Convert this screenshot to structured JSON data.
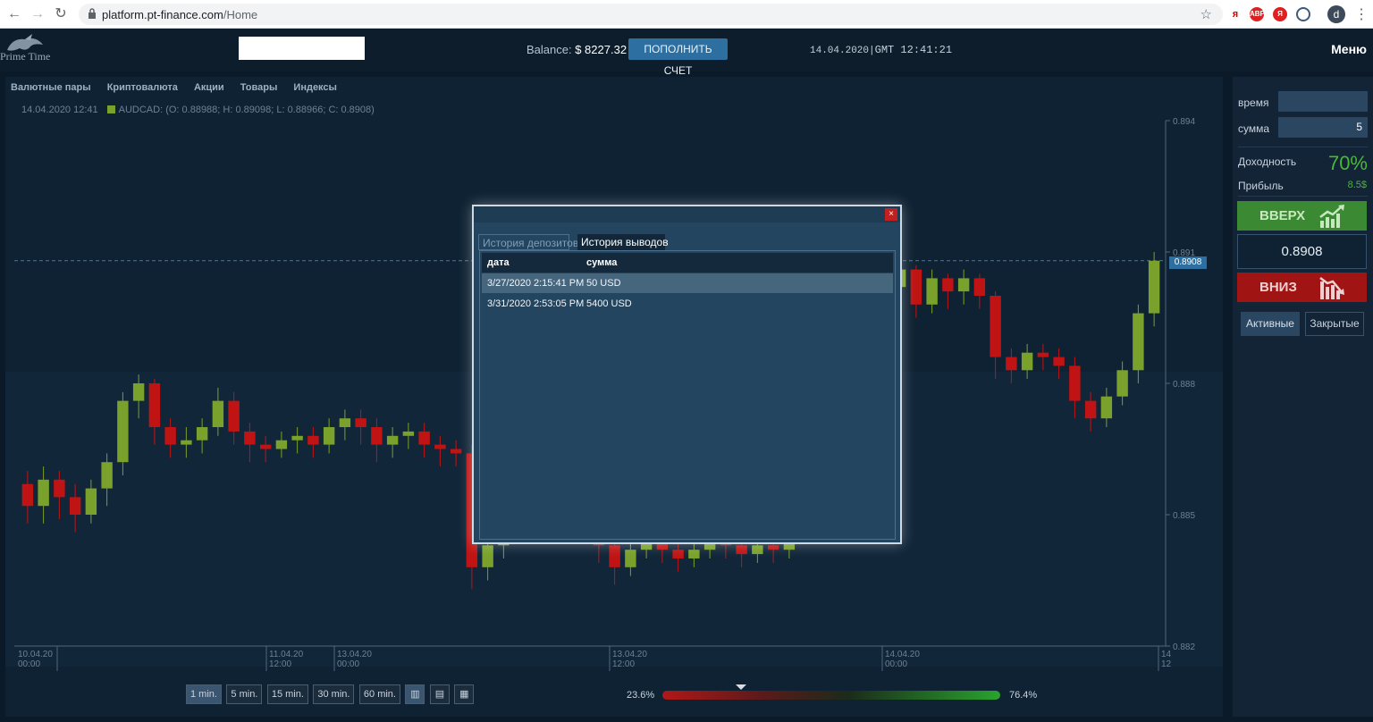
{
  "browser": {
    "url_host": "platform.pt-finance.com",
    "url_path": "/Home",
    "profile_initial": "d"
  },
  "header": {
    "logo_text": "Prime Time",
    "balance_label": "Balance:",
    "balance_value": "$ 8227.32",
    "deposit_button": "ПОПОЛНИТЬ СЧЕТ",
    "date": "14.04.2020",
    "time": "GMT 12:41:21",
    "menu": "Меню"
  },
  "chart": {
    "asset_tabs": [
      "Валютные пары",
      "Криптовалюта",
      "Акции",
      "Товары",
      "Индексы"
    ],
    "ohlc_time": "14.04.2020 12:41",
    "ohlc_text": "AUDCAD: (O: 0.88988; H: 0.89098; L: 0.88966; C: 0.8908)",
    "current_price": "0.8908",
    "price_ticks": [
      "0.894",
      "0.891",
      "0.888",
      "0.885",
      "0.882"
    ],
    "time_ticks": [
      {
        "date": "10.04.20",
        "time": "00:00"
      },
      {
        "date": "11.04.20",
        "time": "12:00"
      },
      {
        "date": "13.04.20",
        "time": "00:00"
      },
      {
        "date": "13.04.20",
        "time": "12:00"
      },
      {
        "date": "14.04.20",
        "time": "00:00"
      },
      {
        "date": "14",
        "time": "12"
      }
    ],
    "timeframes": [
      "1 min.",
      "5 min.",
      "15 min.",
      "30 min.",
      "60 min."
    ],
    "active_timeframe": "1 min.",
    "sentiment_down": "23.6%",
    "sentiment_up": "76.4%"
  },
  "chart_data": {
    "type": "candlestick",
    "symbol": "AUDCAD",
    "ylim": [
      0.882,
      0.894
    ],
    "candles": [
      [
        0.8857,
        0.8852,
        0.8848,
        0.886
      ],
      [
        0.8852,
        0.8858,
        0.8848,
        0.8861
      ],
      [
        0.8858,
        0.8854,
        0.8849,
        0.886
      ],
      [
        0.8854,
        0.885,
        0.8846,
        0.8857
      ],
      [
        0.885,
        0.8856,
        0.8848,
        0.8858
      ],
      [
        0.8856,
        0.8862,
        0.8852,
        0.8864
      ],
      [
        0.8862,
        0.8876,
        0.8859,
        0.8878
      ],
      [
        0.8876,
        0.888,
        0.8872,
        0.8882
      ],
      [
        0.888,
        0.887,
        0.8866,
        0.8881
      ],
      [
        0.887,
        0.8866,
        0.8863,
        0.8872
      ],
      [
        0.8866,
        0.8867,
        0.8863,
        0.887
      ],
      [
        0.8867,
        0.887,
        0.8864,
        0.8872
      ],
      [
        0.887,
        0.8876,
        0.8868,
        0.8879
      ],
      [
        0.8876,
        0.8869,
        0.8866,
        0.8878
      ],
      [
        0.8869,
        0.8866,
        0.8862,
        0.8871
      ],
      [
        0.8866,
        0.8865,
        0.8862,
        0.8868
      ],
      [
        0.8865,
        0.8867,
        0.8863,
        0.8869
      ],
      [
        0.8867,
        0.8868,
        0.8864,
        0.887
      ],
      [
        0.8868,
        0.8866,
        0.8863,
        0.887
      ],
      [
        0.8866,
        0.887,
        0.8864,
        0.8872
      ],
      [
        0.887,
        0.8872,
        0.8867,
        0.8874
      ],
      [
        0.8872,
        0.887,
        0.8866,
        0.8874
      ],
      [
        0.887,
        0.8866,
        0.8862,
        0.8872
      ],
      [
        0.8866,
        0.8868,
        0.8863,
        0.887
      ],
      [
        0.8868,
        0.8869,
        0.8865,
        0.8871
      ],
      [
        0.8869,
        0.8866,
        0.8863,
        0.8871
      ],
      [
        0.8866,
        0.8865,
        0.8861,
        0.8868
      ],
      [
        0.8865,
        0.8864,
        0.8861,
        0.8867
      ],
      [
        0.8864,
        0.8838,
        0.8833,
        0.8866
      ],
      [
        0.8838,
        0.8843,
        0.8835,
        0.8846
      ],
      [
        0.8843,
        0.8866,
        0.884,
        0.887
      ],
      [
        0.8866,
        0.886,
        0.8856,
        0.8868
      ],
      [
        0.886,
        0.8852,
        0.8848,
        0.8862
      ],
      [
        0.8852,
        0.8862,
        0.885,
        0.8864
      ],
      [
        0.8862,
        0.8854,
        0.885,
        0.8864
      ],
      [
        0.8854,
        0.885,
        0.8846,
        0.8857
      ],
      [
        0.885,
        0.8843,
        0.8839,
        0.8852
      ],
      [
        0.8843,
        0.8838,
        0.8834,
        0.8845
      ],
      [
        0.8838,
        0.8842,
        0.8836,
        0.8844
      ],
      [
        0.8842,
        0.8845,
        0.884,
        0.8848
      ],
      [
        0.8845,
        0.8842,
        0.8839,
        0.8847
      ],
      [
        0.8842,
        0.884,
        0.8837,
        0.8844
      ],
      [
        0.884,
        0.8842,
        0.8838,
        0.8844
      ],
      [
        0.8842,
        0.8844,
        0.884,
        0.8846
      ],
      [
        0.8844,
        0.8843,
        0.884,
        0.8846
      ],
      [
        0.8843,
        0.8841,
        0.8838,
        0.8845
      ],
      [
        0.8841,
        0.8843,
        0.8839,
        0.8845
      ],
      [
        0.8843,
        0.8842,
        0.8839,
        0.8845
      ],
      [
        0.8842,
        0.8866,
        0.884,
        0.8869
      ],
      [
        0.8866,
        0.8892,
        0.8863,
        0.8895
      ],
      [
        0.8892,
        0.8908,
        0.8889,
        0.891
      ],
      [
        0.8908,
        0.8901,
        0.8897,
        0.891
      ],
      [
        0.8901,
        0.8899,
        0.8895,
        0.8903
      ],
      [
        0.8899,
        0.8894,
        0.889,
        0.8901
      ],
      [
        0.8894,
        0.8902,
        0.8892,
        0.8904
      ],
      [
        0.8902,
        0.8906,
        0.8899,
        0.8908
      ],
      [
        0.8906,
        0.8898,
        0.8895,
        0.8907
      ],
      [
        0.8898,
        0.8904,
        0.8896,
        0.8906
      ],
      [
        0.8904,
        0.8901,
        0.8897,
        0.8905
      ],
      [
        0.8901,
        0.8904,
        0.8898,
        0.8906
      ],
      [
        0.8904,
        0.89,
        0.8897,
        0.8905
      ],
      [
        0.89,
        0.8886,
        0.8881,
        0.8901
      ],
      [
        0.8886,
        0.8883,
        0.888,
        0.8888
      ],
      [
        0.8883,
        0.8887,
        0.8881,
        0.8889
      ],
      [
        0.8887,
        0.8886,
        0.8883,
        0.8889
      ],
      [
        0.8886,
        0.8884,
        0.8881,
        0.8888
      ],
      [
        0.8884,
        0.8876,
        0.8872,
        0.8886
      ],
      [
        0.8876,
        0.8872,
        0.8869,
        0.8878
      ],
      [
        0.8872,
        0.8877,
        0.887,
        0.8879
      ],
      [
        0.8877,
        0.8883,
        0.8875,
        0.8885
      ],
      [
        0.8883,
        0.8896,
        0.888,
        0.8898
      ],
      [
        0.8896,
        0.8908,
        0.8893,
        0.891
      ]
    ]
  },
  "right_panel": {
    "time_label": "время",
    "time_value": "",
    "amount_label": "сумма",
    "amount_value": "5",
    "yield_label": "Доходность",
    "yield_value": "70%",
    "profit_label": "Прибыль",
    "profit_value": "8.5$",
    "up_button": "ВВЕРХ",
    "price": "0.8908",
    "down_button": "ВНИЗ",
    "tab_active": "Активные",
    "tab_closed": "Закрытые"
  },
  "modal": {
    "close": "×",
    "tab_deposits": "История депозитов",
    "tab_withdrawals": "История выводов",
    "col_date": "дата",
    "col_amount": "сумма",
    "rows": [
      {
        "date": "3/27/2020 2:15:41 PM",
        "amount": "50 USD"
      },
      {
        "date": "3/31/2020 2:53:05 PM",
        "amount": "5400 USD"
      }
    ]
  },
  "colors": {
    "bull": "#7aa12b",
    "bear": "#c01414",
    "accent": "#2c6fa0"
  }
}
